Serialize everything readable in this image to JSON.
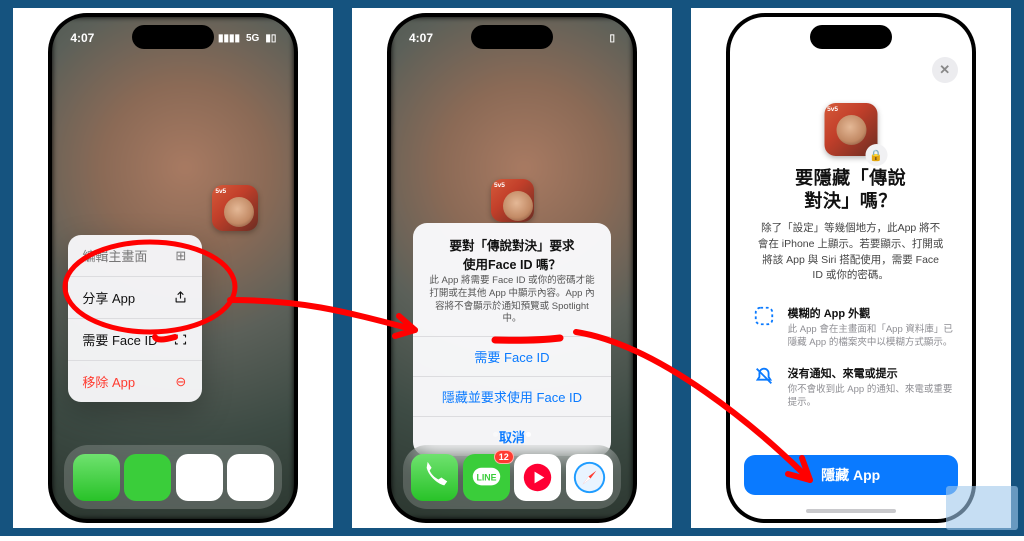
{
  "status": {
    "time": "4:07",
    "network": "5G"
  },
  "app_icon_tag": "5v5",
  "screen1": {
    "menu": {
      "edit": {
        "label": "編輯主畫面",
        "icon_name": "edit-icon"
      },
      "share": {
        "label": "分享 App",
        "icon_name": "share-icon"
      },
      "faceid": {
        "label": "需要 Face ID",
        "icon_name": "faceid-icon"
      },
      "remove": {
        "label": "移除 App",
        "icon_name": "remove-icon"
      }
    }
  },
  "screen2": {
    "alert": {
      "title": "要對「傳說對決」要求\n使用Face ID 嗎？",
      "body": "此 App 將需要 Face ID 或你的密碼才能打開或在其他 App 中顯示內容。App 內容將不會顯示於通知預覽或 Spotlight 中。",
      "btn_require": "需要 Face ID",
      "btn_hide": "隱藏並要求使用 Face ID",
      "btn_cancel": "取消"
    },
    "dock_badge": "12"
  },
  "screen3": {
    "title": "要隱藏「傳說\n對決」嗎？",
    "subtitle": "除了「設定」等幾個地方，此App 將不會在 iPhone 上顯示。若要顯示、打開或將該 App 與 Siri 搭配使用，需要 Face ID 或你的密碼。",
    "feature1": {
      "title": "模糊的 App 外觀",
      "desc": "此 App 會在主畫面和「App 資料庫」已隱藏 App 的檔案夾中以模糊方式顯示。"
    },
    "feature2": {
      "title": "沒有通知、來電或提示",
      "desc": "你不會收到此 App 的通知、來電或重要提示。"
    },
    "cta": "隱藏 App"
  }
}
